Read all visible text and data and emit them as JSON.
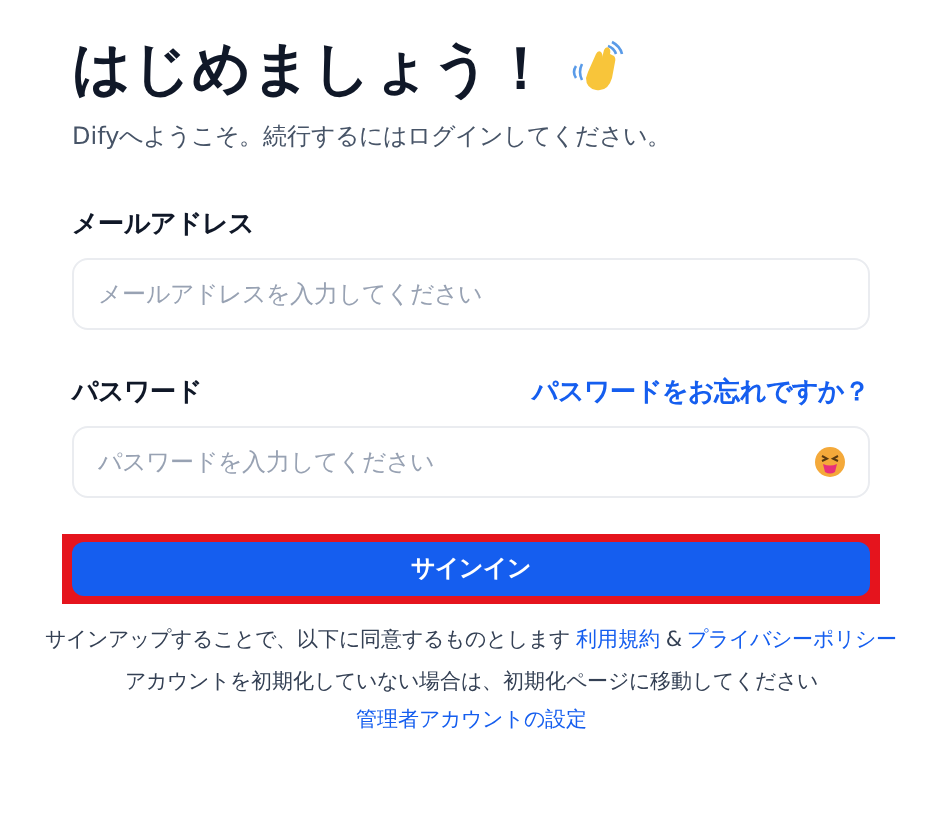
{
  "header": {
    "title": "はじめましょう！",
    "subtitle": "Difyへようこそ。続行するにはログインしてください。"
  },
  "fields": [
    {
      "label": "メールアドレス",
      "placeholder": "メールアドレスを入力してください",
      "kind": "email"
    },
    {
      "label": "パスワード",
      "placeholder": "パスワードを入力してください",
      "kind": "password",
      "link": "パスワードをお忘れですか？"
    }
  ],
  "submit": {
    "label": "サインイン",
    "highlighted": true
  },
  "notes": [
    {
      "text": "サインアップすることで、以下に同意するものとします",
      "links": [
        "利用規約",
        "&",
        "プライバシーポリシー"
      ]
    },
    {
      "text": "アカウントを初期化していない場合は、初期化ページに移動してください",
      "links": [
        "管理者アカウントの設定"
      ]
    }
  ]
}
